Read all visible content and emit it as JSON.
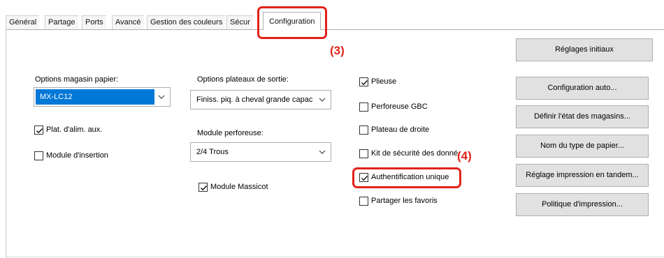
{
  "tabs": [
    {
      "label": "Général"
    },
    {
      "label": "Partage"
    },
    {
      "label": "Ports"
    },
    {
      "label": "Avancé"
    },
    {
      "label": "Gestion des couleurs"
    },
    {
      "label": "Sécur"
    },
    {
      "label": "Configuration"
    }
  ],
  "callouts": {
    "c3": "(3)",
    "c4": "(4)"
  },
  "colors": {
    "callout": "#e2231a",
    "selection": "#0078d7"
  },
  "paper_tray": {
    "label": "Options magasin papier:",
    "selected": "MX-LC12",
    "aux_feed": {
      "label": "Plat. d'alim. aux.",
      "checked": true
    },
    "insertion": {
      "label": "Module d'insertion",
      "checked": false
    }
  },
  "output_tray": {
    "label": "Options plateaux de sortie:",
    "selected": "Finiss. piq. à cheval grande capac",
    "punch_label": "Module perforeuse:",
    "punch_selected": "2/4 Trous",
    "trimmer": {
      "label": "Module Massicot",
      "checked": true
    }
  },
  "options": [
    {
      "label": "Plieuse",
      "checked": true
    },
    {
      "label": "Perforeuse GBC",
      "checked": false
    },
    {
      "label": "Plateau de droite",
      "checked": false
    },
    {
      "label": "Kit de sécurité des donné",
      "checked": false
    },
    {
      "label": "Authentification unique",
      "checked": true
    },
    {
      "label": "Partager les favoris",
      "checked": false
    }
  ],
  "buttons": {
    "initial": "Réglages initiaux",
    "auto_config": "Configuration auto...",
    "tray_status": "Définir l'état des magasins...",
    "paper_type": "Nom du type de papier...",
    "tandem": "Réglage impression en tandem...",
    "policy": "Politique d'impression..."
  }
}
